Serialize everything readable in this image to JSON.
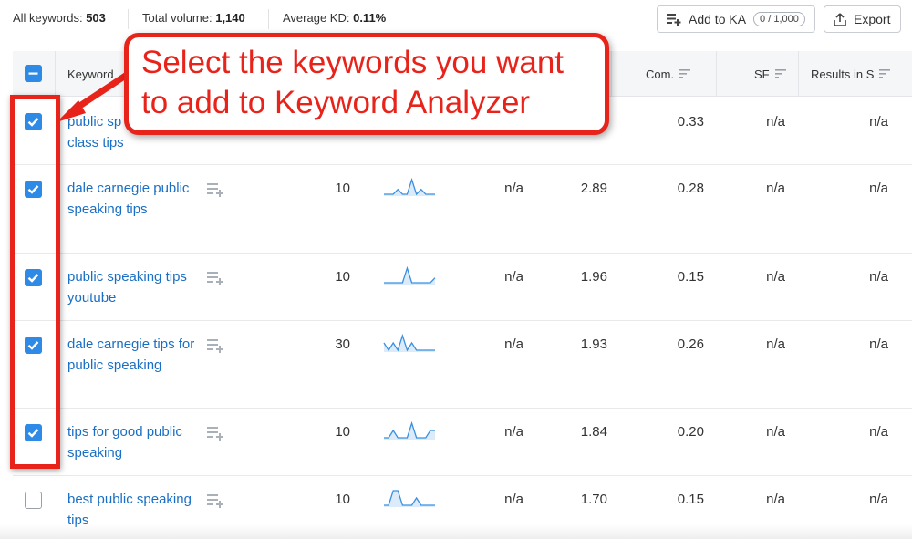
{
  "summary": {
    "all_keywords_label": "All keywords:",
    "all_keywords_value": "503",
    "total_volume_label": "Total volume:",
    "total_volume_value": "1,140",
    "average_kd_label": "Average KD:",
    "average_kd_value": "0.11%"
  },
  "toolbar": {
    "add_to_ka_label": "Add to KA",
    "add_to_ka_count": "0 / 1,000",
    "export_label": "Export"
  },
  "table": {
    "columns": {
      "keyword": "Keyword",
      "com": "Com.",
      "sf": "SF",
      "results": "Results in S"
    },
    "rows": [
      {
        "keyword": "public speaking class tips",
        "keyword_visible": "public sp",
        "keyword_line2": "class tips",
        "checked": true,
        "volume": "",
        "kd": "",
        "cpc": "",
        "com": "0.33",
        "sf": "n/a",
        "results": "n/a",
        "trend": []
      },
      {
        "keyword": "dale carnegie public speaking tips",
        "checked": true,
        "volume": "10",
        "kd": "n/a",
        "cpc": "2.89",
        "com": "0.28",
        "sf": "n/a",
        "results": "n/a",
        "trend": [
          0,
          0,
          0,
          1,
          0,
          0,
          3,
          0,
          1,
          0,
          0,
          0
        ]
      },
      {
        "keyword": "public speaking tips youtube",
        "checked": true,
        "volume": "10",
        "kd": "n/a",
        "cpc": "1.96",
        "com": "0.15",
        "sf": "n/a",
        "results": "n/a",
        "trend": [
          0,
          0,
          0,
          0,
          0,
          3,
          0,
          0,
          0,
          0,
          0,
          1
        ]
      },
      {
        "keyword": "dale carnegie tips for public speaking",
        "checked": true,
        "volume": "30",
        "kd": "n/a",
        "cpc": "1.93",
        "com": "0.26",
        "sf": "n/a",
        "results": "n/a",
        "trend": [
          1,
          0,
          1,
          0,
          2,
          0,
          1,
          0,
          0,
          0,
          0,
          0
        ]
      },
      {
        "keyword": "tips for good public speaking",
        "checked": true,
        "volume": "10",
        "kd": "n/a",
        "cpc": "1.84",
        "com": "0.20",
        "sf": "n/a",
        "results": "n/a",
        "trend": [
          0,
          0,
          1,
          0,
          0,
          0,
          2,
          0,
          0,
          0,
          1,
          1
        ]
      },
      {
        "keyword": "best public speaking tips",
        "checked": false,
        "volume": "10",
        "kd": "n/a",
        "cpc": "1.70",
        "com": "0.15",
        "sf": "n/a",
        "results": "n/a",
        "trend": [
          0,
          0,
          2,
          2,
          0,
          0,
          0,
          1,
          0,
          0,
          0,
          0
        ]
      }
    ]
  },
  "annotation": {
    "text_line1": "Select the keywords you want",
    "text_line2": "to add to Keyword Analyzer"
  },
  "colors": {
    "accent": "#2d8ae6",
    "link": "#1a6fc4",
    "annotation": "#e8231a"
  },
  "icons": {
    "add_to_ka": "add-list-icon",
    "export": "export-icon",
    "sort": "sort-icon",
    "row_add": "add-to-list-icon"
  }
}
